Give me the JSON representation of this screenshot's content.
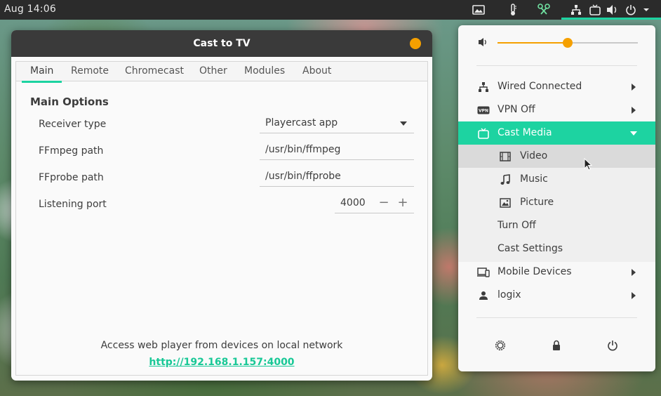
{
  "topbar": {
    "clock": "Aug  14:06",
    "tray_icons": [
      "image-viewer-icon",
      "thermometer-icon",
      "indicator-icon",
      "network-wired-icon",
      "cast-tv-icon",
      "volume-icon",
      "power-icon",
      "chevron-down-icon"
    ],
    "accent": "#1dd3a1"
  },
  "window": {
    "title": "Cast to TV",
    "tabs": [
      {
        "label": "Main",
        "active": true
      },
      {
        "label": "Remote",
        "active": false
      },
      {
        "label": "Chromecast",
        "active": false
      },
      {
        "label": "Other",
        "active": false
      },
      {
        "label": "Modules",
        "active": false
      },
      {
        "label": "About",
        "active": false
      }
    ],
    "section_title": "Main Options",
    "rows": {
      "receiver": {
        "label": "Receiver type",
        "value": "Playercast app"
      },
      "ffmpeg": {
        "label": "FFmpeg path",
        "value": "/usr/bin/ffmpeg"
      },
      "ffprobe": {
        "label": "FFprobe path",
        "value": "/usr/bin/ffprobe"
      },
      "port": {
        "label": "Listening port",
        "value": "4000",
        "minus": "−",
        "plus": "+"
      }
    },
    "footer_text": "Access web player from devices on local network",
    "footer_link": "http://192.168.1.157:4000",
    "close_color": "#f5a000"
  },
  "system_menu": {
    "volume_level": 0.5,
    "items": {
      "wired": {
        "label": "Wired Connected",
        "icon": "network-wired-icon"
      },
      "vpn": {
        "label": "VPN Off",
        "icon": "vpn-icon"
      },
      "cast": {
        "label": "Cast Media",
        "icon": "cast-tv-icon"
      },
      "video": {
        "label": "Video",
        "icon": "film-icon"
      },
      "music": {
        "label": "Music",
        "icon": "music-note-icon"
      },
      "picture": {
        "label": "Picture",
        "icon": "picture-icon"
      },
      "turn_off": {
        "label": "Turn Off"
      },
      "cast_settings": {
        "label": "Cast Settings"
      },
      "mobile": {
        "label": "Mobile Devices",
        "icon": "mobile-devices-icon"
      },
      "user": {
        "label": "logix",
        "icon": "user-icon"
      }
    },
    "bottom_buttons": [
      "settings-icon",
      "lock-icon",
      "power-icon"
    ],
    "highlight_color": "#1dd3a1",
    "slider_color": "#f5a000"
  }
}
